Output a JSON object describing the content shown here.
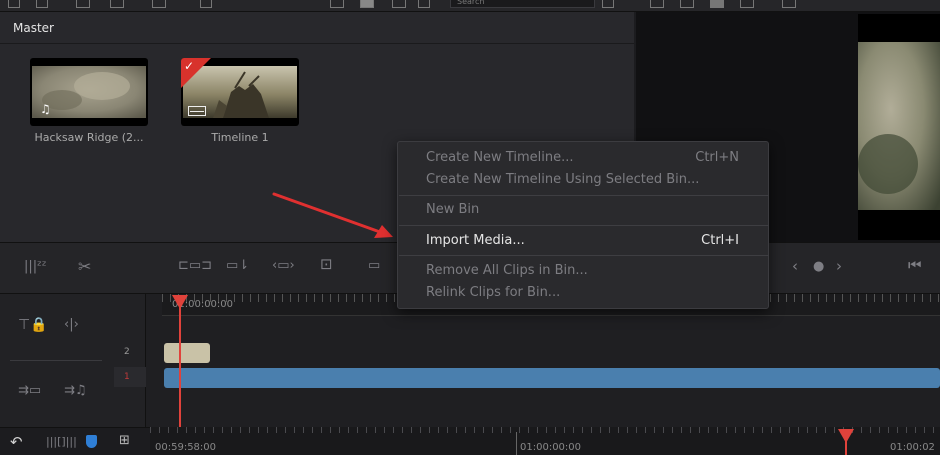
{
  "top_toolbar": {
    "search_placeholder": "Search"
  },
  "media_pool": {
    "bin_label": "Master",
    "clips": [
      {
        "name": "Hacksaw Ridge (2...",
        "type_icon": "music-note-icon",
        "selected": false
      },
      {
        "name": "Timeline 1",
        "type_icon": "timeline-icon",
        "selected": true
      }
    ]
  },
  "context_menu": {
    "items": [
      {
        "label": "Create New Timeline...",
        "shortcut": "Ctrl+N",
        "enabled": false
      },
      {
        "label": "Create New Timeline Using Selected Bin...",
        "shortcut": "",
        "enabled": false
      },
      {
        "label": "New Bin",
        "shortcut": "",
        "enabled": false
      },
      {
        "label": "Import Media...",
        "shortcut": "Ctrl+I",
        "enabled": true
      },
      {
        "label": "Remove All Clips in Bin...",
        "shortcut": "",
        "enabled": false
      },
      {
        "label": "Relink Clips for Bin...",
        "shortcut": "",
        "enabled": false
      }
    ]
  },
  "timeline": {
    "ruler_timecode": "01:00:00:00",
    "tracks": [
      {
        "number": "2"
      },
      {
        "number": "1"
      }
    ]
  },
  "bottom_ruler": {
    "timecodes": [
      "00:59:58:00",
      "01:00:00:00",
      "01:00:02"
    ]
  },
  "colors": {
    "accent_red": "#e0423b",
    "clip_blue": "#4a7fae",
    "clip_beige": "#c9c2a7",
    "annotation_arrow": "#e03030"
  }
}
